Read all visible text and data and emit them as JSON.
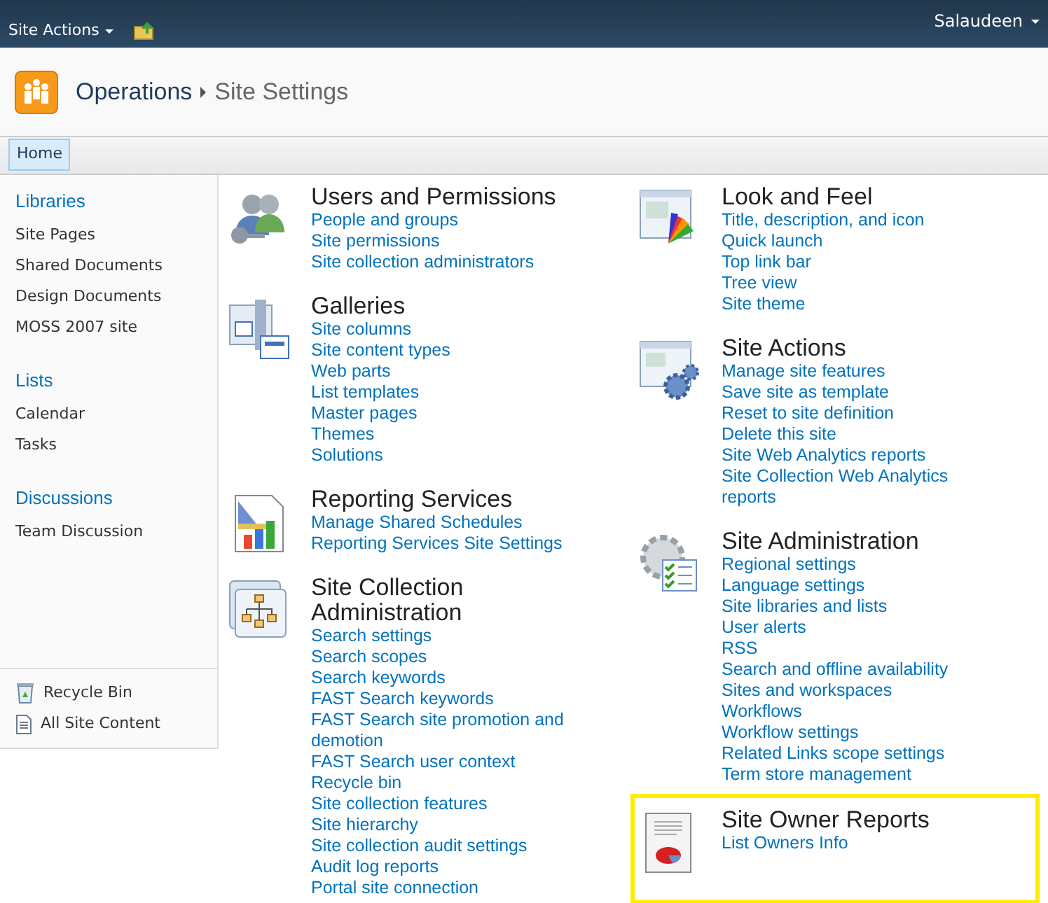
{
  "top_bar": {
    "site_actions": "Site Actions",
    "user": "Salaudeen"
  },
  "breadcrumb": {
    "site": "Operations",
    "page": "Site Settings"
  },
  "nav_tabs": [
    {
      "label": "Home",
      "selected": true
    }
  ],
  "quick_launch": {
    "groups": [
      {
        "heading": "Libraries",
        "items": [
          "Site Pages",
          "Shared Documents",
          "Design Documents",
          "MOSS 2007 site"
        ]
      },
      {
        "heading": "Lists",
        "items": [
          "Calendar",
          "Tasks"
        ]
      },
      {
        "heading": "Discussions",
        "items": [
          "Team Discussion"
        ]
      }
    ],
    "footer": [
      {
        "kind": "recycle",
        "label": "Recycle Bin"
      },
      {
        "kind": "content",
        "label": "All Site Content"
      }
    ]
  },
  "columns": [
    [
      {
        "title": "Users and Permissions",
        "highlighted": false,
        "links": [
          "People and groups",
          "Site permissions",
          "Site collection administrators"
        ]
      },
      {
        "title": "Galleries",
        "highlighted": false,
        "links": [
          "Site columns",
          "Site content types",
          "Web parts",
          "List templates",
          "Master pages",
          "Themes",
          "Solutions"
        ]
      },
      {
        "title": "Reporting Services",
        "highlighted": false,
        "links": [
          "Manage Shared Schedules",
          "Reporting Services Site Settings"
        ]
      },
      {
        "title": "Site Collection Administration",
        "highlighted": false,
        "links": [
          "Search settings",
          "Search scopes",
          "Search keywords",
          "FAST Search keywords",
          "FAST Search site promotion and demotion",
          "FAST Search user context",
          "Recycle bin",
          "Site collection features",
          "Site hierarchy",
          "Site collection audit settings",
          "Audit log reports",
          "Portal site connection"
        ]
      }
    ],
    [
      {
        "title": "Look and Feel",
        "highlighted": false,
        "links": [
          "Title, description, and icon",
          "Quick launch",
          "Top link bar",
          "Tree view",
          "Site theme"
        ]
      },
      {
        "title": "Site Actions",
        "highlighted": false,
        "links": [
          "Manage site features",
          "Save site as template",
          "Reset to site definition",
          "Delete this site",
          "Site Web Analytics reports",
          "Site Collection Web Analytics reports"
        ]
      },
      {
        "title": "Site Administration",
        "highlighted": false,
        "links": [
          "Regional settings",
          "Language settings",
          "Site libraries and lists",
          "User alerts",
          "RSS",
          "Search and offline availability",
          "Sites and workspaces",
          "Workflows",
          "Workflow settings",
          "Related Links scope settings",
          "Term store management"
        ]
      },
      {
        "title": "Site Owner Reports",
        "highlighted": true,
        "links": [
          "List Owners Info"
        ]
      }
    ]
  ]
}
